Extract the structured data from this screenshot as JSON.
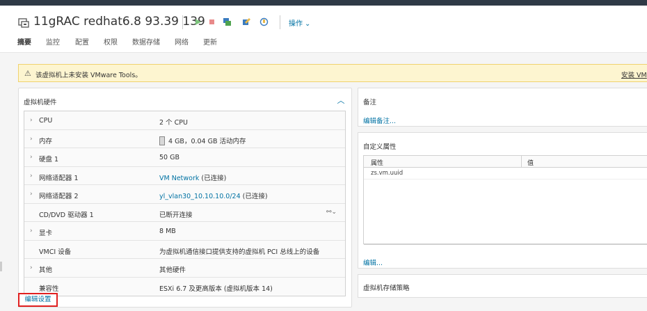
{
  "header": {
    "vm_title": "11gRAC redhat6.8 93.39 139",
    "actions_label": "操作",
    "colors": {
      "accent": "#0072a3",
      "topbar": "#2f3a46"
    },
    "toolbar_icons": [
      "power-on-icon",
      "power-off-icon",
      "console-icon",
      "edit-icon",
      "snapshot-icon"
    ]
  },
  "tabs": [
    "摘要",
    "监控",
    "配置",
    "权限",
    "数据存储",
    "网络",
    "更新"
  ],
  "alert": {
    "text": "该虚拟机上未安装 VMware Tools。",
    "link": "安装 VM",
    "colors": {
      "bg": "#fdf5d0",
      "border": "#f0d26e"
    }
  },
  "hardware": {
    "title": "虚拟机硬件",
    "rows": [
      {
        "label": "CPU",
        "value": "2 个 CPU",
        "expandable": true
      },
      {
        "label": "内存",
        "value": "4 GB，0.04 GB 活动内存",
        "expandable": true
      },
      {
        "label": "硬盘 1",
        "value": "50 GB",
        "expandable": true
      },
      {
        "label": "网络适配器 1",
        "value_link": "VM Network",
        "value_suffix": " (已连接)",
        "expandable": true
      },
      {
        "label": "网络适配器 2",
        "value_link": "yl_vlan30_10.10.10.0/24",
        "value_suffix": " (已连接)",
        "expandable": true
      },
      {
        "label": "CD/DVD 驱动器 1",
        "value": "已断开连接",
        "expandable": false
      },
      {
        "label": "显卡",
        "value": "8 MB",
        "expandable": true
      },
      {
        "label": "VMCI 设备",
        "value": "为虚拟机通信接口提供支持的虚拟机 PCI 总线上的设备",
        "expandable": false
      },
      {
        "label": "其他",
        "value": "其他硬件",
        "expandable": true
      },
      {
        "label": "兼容性",
        "value": "ESXi 6.7 及更高版本 (虚拟机版本 14)",
        "expandable": false
      }
    ],
    "edit_link": "编辑设置"
  },
  "notes": {
    "title": "备注",
    "edit_link": "编辑备注..."
  },
  "custom_attributes": {
    "title": "自定义属性",
    "columns": [
      "属性",
      "值"
    ],
    "rows": [
      {
        "attribute": "zs.vm.uuid",
        "value": ""
      }
    ],
    "edit_link": "编辑..."
  },
  "storage_policy": {
    "title": "虚拟机存储策略"
  }
}
